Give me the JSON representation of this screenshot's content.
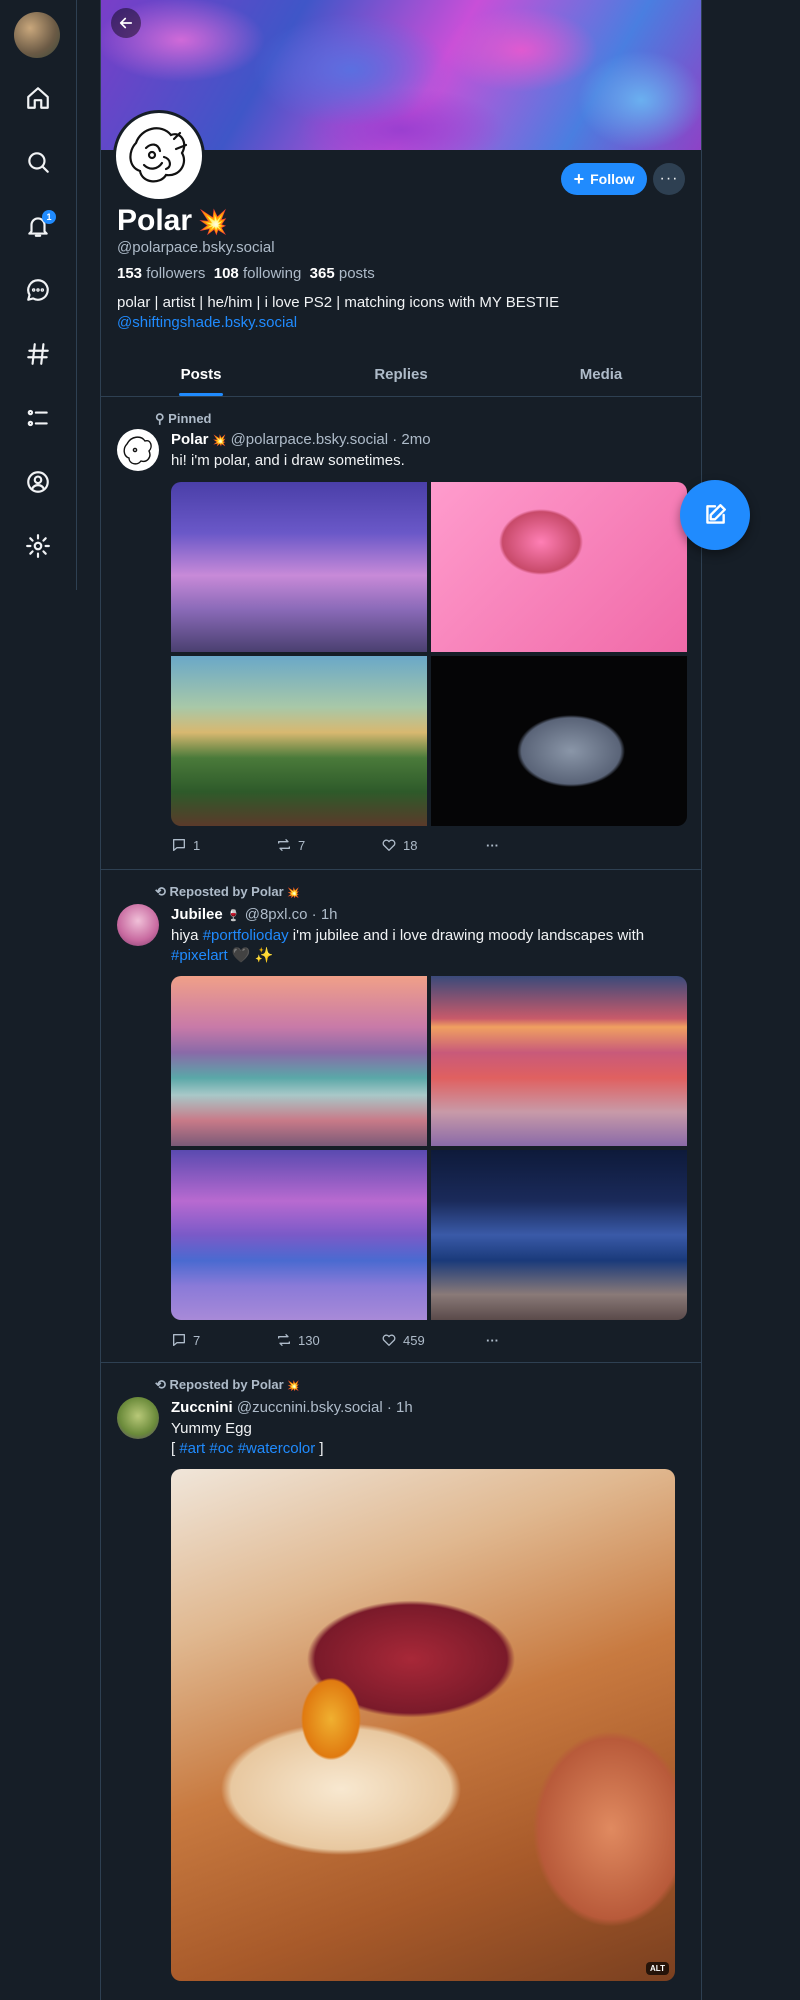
{
  "sidebar": {
    "notification_count": "1",
    "items": [
      "home-icon",
      "search-icon",
      "bell-icon",
      "chat-icon",
      "hash-icon",
      "list-icon",
      "profile-icon",
      "gear-icon"
    ]
  },
  "profile": {
    "display_name": "Polar",
    "name_emoji": "💥",
    "handle": "@polarpace.bsky.social",
    "followers_count": "153",
    "followers_label": "followers",
    "following_count": "108",
    "following_label": "following",
    "posts_count": "365",
    "posts_label": "posts",
    "bio": "polar | artist | he/him | i love PS2 | matching icons with MY BESTIE",
    "bio_link": "@shiftingshade.bsky.social",
    "follow_label": "Follow",
    "more_label": "···"
  },
  "tabs": [
    {
      "label": "Posts",
      "active": true
    },
    {
      "label": "Replies",
      "active": false
    },
    {
      "label": "Media",
      "active": false
    }
  ],
  "posts": [
    {
      "context": "Pinned",
      "name": "Polar",
      "emoji": "💥",
      "handle_time": "@polarpace.bsky.social · 2mo",
      "text": "hi! i'm polar, and i draw sometimes.",
      "replies": "1",
      "reposts": "7",
      "likes": "18"
    },
    {
      "context": "Reposted by Polar",
      "context_emoji": "💥",
      "name": "Jubilee",
      "emoji": "🍷",
      "handle_time": "@8pxl.co · 1h",
      "text_prefix": "hiya ",
      "tag1": "#portfolioday",
      "text_mid": " i'm jubilee and i love drawing moody landscapes with",
      "tag2": "#pixelart",
      "text_suffix": " 🖤 ✨",
      "replies": "7",
      "reposts": "130",
      "likes": "459"
    },
    {
      "context": "Reposted by Polar",
      "context_emoji": "💥",
      "name": "Zuccnini",
      "handle_time": "@zuccnini.bsky.social · 1h",
      "text": "Yummy Egg",
      "tags_open": "[ ",
      "tags": "#art #oc #watercolor",
      "tags_close": " ]",
      "alt_label": "ALT"
    }
  ],
  "more_actions": "···"
}
